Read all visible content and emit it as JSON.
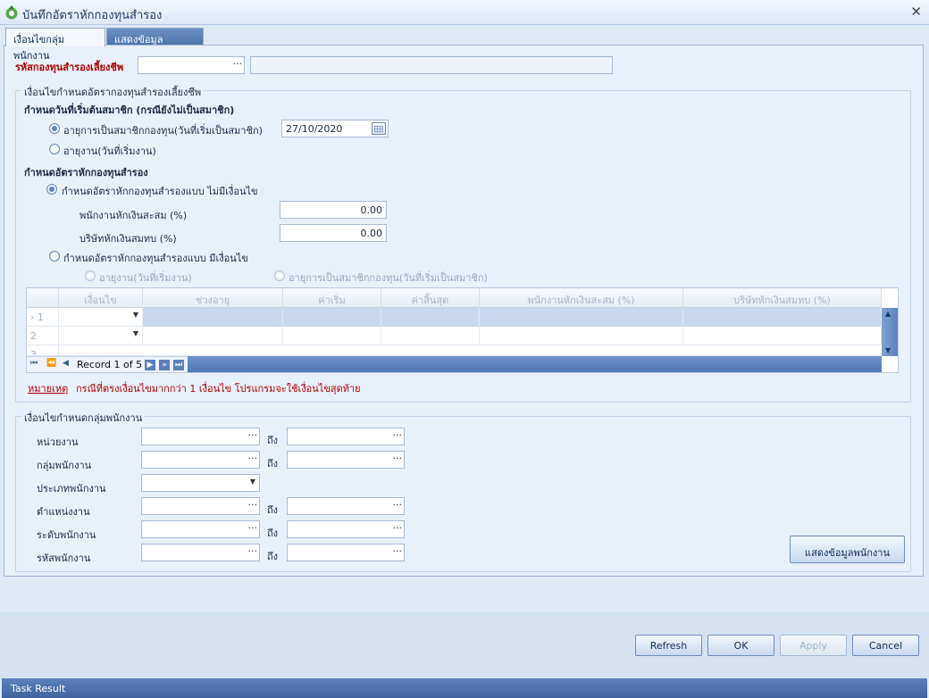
{
  "window": {
    "title": "บันทึกอัตราหักกองทุนสำรอง"
  },
  "tabs": [
    {
      "label": "เงื่อนไขกลุ่มพนักงาน",
      "active": true
    },
    {
      "label": "แสดงข้อมูลพนักงาน",
      "active": false
    }
  ],
  "fund_code": {
    "label": "รหัสกองทุนสำรองเลี้ยงชีพ",
    "value": "",
    "name_value": ""
  },
  "rate_condition": {
    "group_title": "เงื่อนไขกำหนดอัตรากองทุนสำรองเลี้ยงชีพ",
    "start_date_heading": "กำหนดวันที่เริ่มต้นสมาชิก (กรณียังไม่เป็นสมาชิก)",
    "opt_member_age": "อายุการเป็นสมาชิกกองทุน(วันที่เริ่มเป็นสมาชิก)",
    "opt_work_age": "อายุงาน(วันที่เริ่มงาน)",
    "member_date": "27/10/2020",
    "rate_heading": "กำหนดอัตราหักกองทุนสำรอง",
    "opt_no_condition": "กำหนดอัตราหักกองทุนสำรองแบบ ไม่มีเงื่อนไข",
    "employee_label": "พนักงานหักเงินสะสม (%)",
    "employee_value": "0.00",
    "company_label": "บริษัทหักเงินสมทบ (%)",
    "company_value": "0.00",
    "opt_with_condition": "กำหนดอัตราหักกองทุนสำรองแบบ มีเงื่อนไข",
    "sub_work_age": "อายุงาน(วันที่เริ่มงาน)",
    "sub_member_age": "อายุการเป็นสมาชิกกองทุน(วันที่เริ่มเป็นสมาชิก)"
  },
  "grid": {
    "columns": [
      "เงื่อนไข",
      "ช่วงอายุ",
      "ค่าเริ่ม",
      "ค่าสิ้นสุด",
      "พนักงานหักเงินสะสม (%)",
      "บริษัทหักเงินสมทบ (%)"
    ],
    "rows": [
      "1",
      "2",
      "3"
    ],
    "record_text": "Record 1 of 5"
  },
  "note": {
    "label": "หมายเหตุ",
    "text": "กรณีที่ตรงเงื่อนไขมากกว่า 1 เงื่อนไข โปรแกรมจะใช้เงื่อนไขสุดท้าย"
  },
  "employee_group": {
    "group_title": "เงื่อนไขกำหนดกลุ่มพนักงาน",
    "to_label": "ถึง",
    "fields": {
      "department": "หน่วยงาน",
      "emp_group": "กลุ่มพนักงาน",
      "emp_type": "ประเภทพนักงาน",
      "position": "ตำแหน่งงาน",
      "level": "ระดับพนักงาน",
      "emp_code": "รหัสพนักงาน"
    },
    "show_button": "แสดงข้อมูลพนักงาน"
  },
  "buttons": {
    "refresh": "Refresh",
    "ok": "OK",
    "apply": "Apply",
    "cancel": "Cancel"
  },
  "task_bar": {
    "label": "Task Result"
  }
}
